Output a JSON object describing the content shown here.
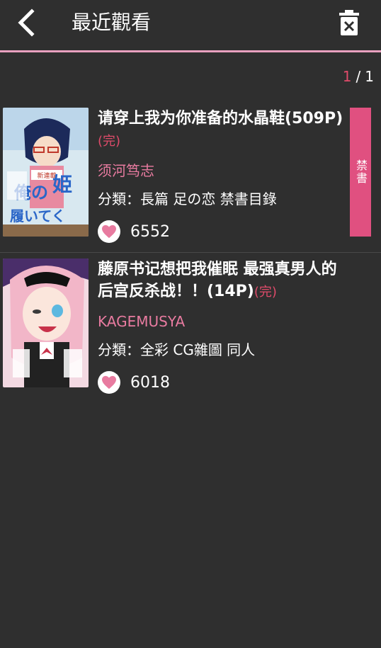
{
  "header": {
    "title": "最近觀看"
  },
  "pager": {
    "current": "1",
    "separator": "/",
    "total": "1"
  },
  "colors": {
    "accent": "#e04b6a",
    "author": "#e87ba0",
    "divider": "#e8a0bf",
    "tag_bg": "#e05080",
    "background": "#2f2f2f"
  },
  "items": [
    {
      "title": "请穿上我为你准备的水晶鞋(509P)",
      "status": "(完)",
      "author": "须河笃志",
      "category_label": "分類：",
      "category_value": "長篇 足の恋 禁書目錄",
      "likes": "6552",
      "tag": "禁書",
      "cover_icon": "manga-cover-1"
    },
    {
      "title": "藤原书记想把我催眠 最强真男人的后宫反杀战！！(14P)",
      "status": "(完)",
      "author": "KAGEMUSYA",
      "category_label": "分類：",
      "category_value": "全彩 CG雜圖 同人",
      "likes": "6018",
      "tag": "",
      "cover_icon": "manga-cover-2"
    }
  ]
}
